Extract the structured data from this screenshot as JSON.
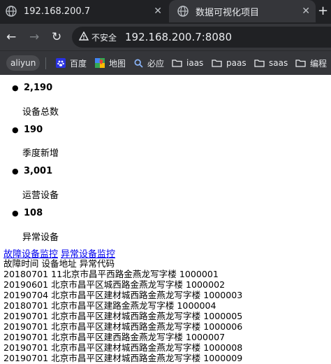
{
  "tabs": [
    {
      "title": "192.168.200.7",
      "icon": "globe-icon"
    },
    {
      "title": "数据可视化项目",
      "icon": "globe-icon"
    }
  ],
  "toolbar": {
    "security_label": "不安全",
    "url": "192.168.200.7:8080"
  },
  "bookmarks": [
    {
      "label": "aliyun"
    },
    {
      "label": "百度",
      "icon": "baidu-paw-icon"
    },
    {
      "label": "地图",
      "icon": "map-pin-icon"
    },
    {
      "label": "必应",
      "icon": "search-icon"
    },
    {
      "label": "iaas",
      "icon": "folder-icon"
    },
    {
      "label": "paas",
      "icon": "folder-icon"
    },
    {
      "label": "saas",
      "icon": "folder-icon"
    },
    {
      "label": "编程",
      "icon": "folder-icon"
    }
  ],
  "stats": [
    {
      "value": "2,190",
      "label": "设备总数"
    },
    {
      "value": "190",
      "label": "季度新增"
    },
    {
      "value": "3,001",
      "label": "运营设备"
    },
    {
      "value": "108",
      "label": "异常设备"
    }
  ],
  "links": [
    "故障设备监控",
    "异常设备监控"
  ],
  "table": {
    "header": "故障时间 设备地址 异常代码",
    "rows": [
      "20180701 11北京市昌平西路金燕龙写字楼 1000001",
      "20190601 北京市昌平区城西路金燕龙写字楼 1000002",
      "20190704 北京市昌平区建材城西路金燕龙写字楼 1000003",
      "20180701 北京市昌平区建路金燕龙写字楼 1000004",
      "20190701 北京市昌平区建材城西路金燕龙写字楼 1000005",
      "20190701 北京市昌平区建材城西路金燕龙写字楼 1000006",
      "20190701 北京市昌平区建西路金燕龙写字楼 1000007",
      "20190701 北京市昌平区建材城西路金燕龙写字楼 1000008",
      "20190701 北京市昌平区建材城西路金燕龙写字楼 1000009"
    ]
  }
}
